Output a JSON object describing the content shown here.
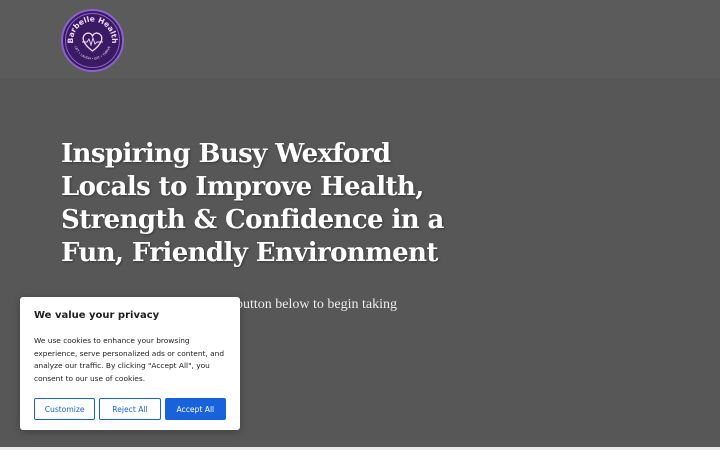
{
  "brand": {
    "name": "Barbelle Health",
    "tagline": "LIFT • LAUGH • EAT • THRIVE",
    "colors": {
      "logo_bg": "#3a1a63",
      "logo_ring": "#8a63c9",
      "logo_text": "#f3d9ff"
    }
  },
  "hero": {
    "headline": "Inspiring Busy Wexford Locals to Improve  Health, Strength & Confidence in a Fun, Friendly Environment",
    "subtext": "button below to begin taking"
  },
  "cookie_banner": {
    "title": "We value your privacy",
    "body": "We use cookies to enhance your browsing experience, serve personalized ads or content, and analyze our traffic. By clicking \"Accept All\", you consent to our use of cookies.",
    "customize_label": "Customize",
    "reject_label": "Reject All",
    "accept_label": "Accept All",
    "accent_color": "#1863dc"
  },
  "icons": {
    "logo_mark": "heart-barbell-icon"
  }
}
